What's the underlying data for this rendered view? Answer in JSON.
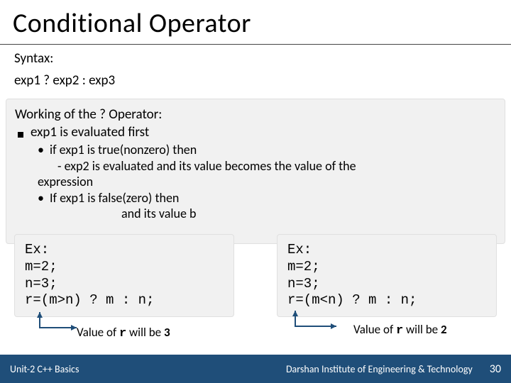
{
  "title": "Conditional Operator",
  "syntax_label": "Syntax:",
  "syntax_code": "exp1 ? exp2 : exp3",
  "working": {
    "heading": "Working of the ? Operator:",
    "bullet1": "exp1 is evaluated first",
    "sub1_prefix": "if ",
    "sub1_body": "exp1 is true(nonzero) then",
    "sub1_dash": "exp2 is evaluated and its value becomes the value of the",
    "sub1_dash_cont": "expression",
    "sub2_prefix": "If ",
    "sub2_body": "exp1 is false(zero) then",
    "sub2_cut": "and its value b"
  },
  "ex1": {
    "label": "Ex:",
    "l1": "m=2;",
    "l2": "n=3;",
    "l3": "r=(m>n) ? m : n;"
  },
  "ex2": {
    "label": "Ex:",
    "l1": "m=2;",
    "l2": "n=3;",
    "l3": "r=(m<n) ? m : n;"
  },
  "cap1_pre": "Value of ",
  "cap1_var": "r",
  "cap1_mid": " will be ",
  "cap1_val": "3",
  "cap2_pre": "Value of ",
  "cap2_var": "r",
  "cap2_mid": " will be ",
  "cap2_val": "2",
  "footer": {
    "left": "Unit-2 C++ Basics",
    "right": "Darshan Institute of Engineering & Technology",
    "page": "30"
  },
  "colors": {
    "footer_bg": "#1f4e79",
    "arrow": "#1f4e79",
    "box_bg": "#f1f1f1"
  }
}
